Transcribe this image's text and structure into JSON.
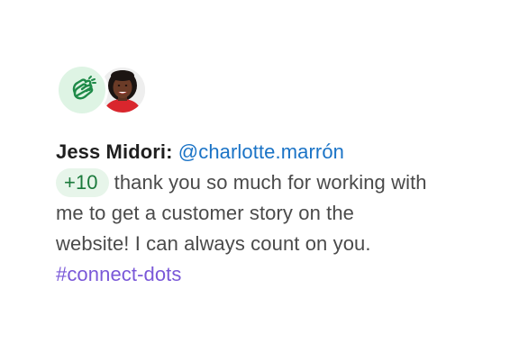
{
  "post": {
    "author": "Jess Midori:",
    "mention": "@charlotte.marrón",
    "points": "+10",
    "message_line1": "thank you so much for working with",
    "message_line2": "me to get a customer story on the",
    "message_line3": "website! I can always count on you.",
    "hashtag": "#connect-dots"
  },
  "icons": {
    "reaction": "clapping-hands-icon",
    "recipient_avatar": "avatar"
  },
  "colors": {
    "mention": "#1a73c6",
    "points_text": "#1b7a3c",
    "points_bg": "#e7f5ea",
    "hashtag": "#7a58d8",
    "clap_bg": "#def4e4"
  }
}
